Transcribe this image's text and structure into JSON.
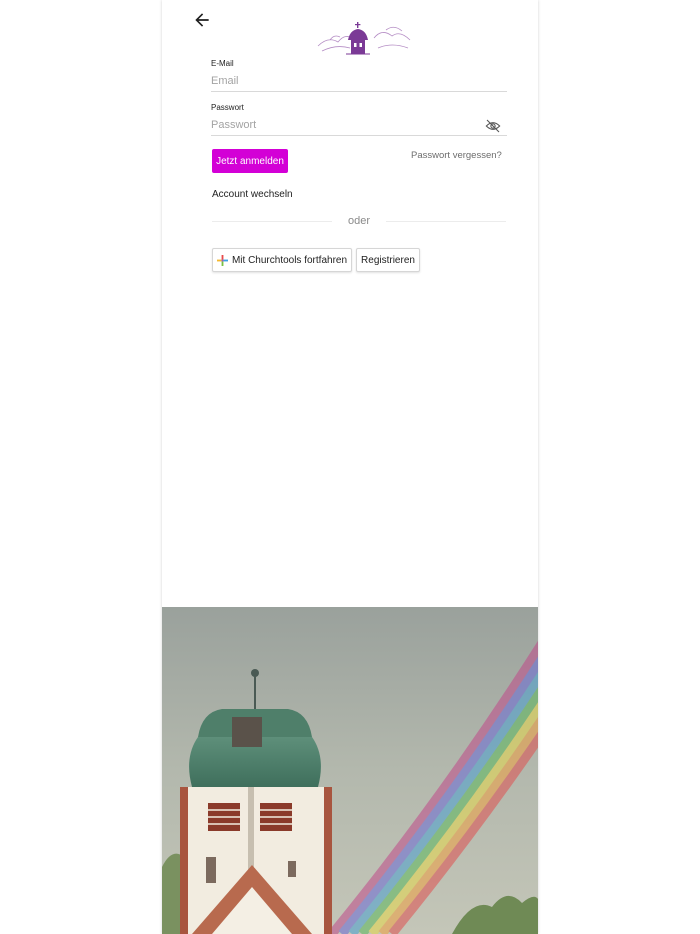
{
  "colors": {
    "accent": "#d300d6",
    "logo": "#7b3a96"
  },
  "nav": {
    "back_icon": "arrow-left-icon"
  },
  "login": {
    "email_label": "E-Mail",
    "email_placeholder": "Email",
    "password_label": "Passwort",
    "password_placeholder": "Passwort",
    "password_toggle_icon": "eye-off-icon",
    "submit_label": "Jetzt anmelden",
    "forgot_label": "Passwort vergessen?",
    "switch_account_label": "Account wechseln",
    "divider_label": "oder",
    "churchtools_label": "Mit Churchtools fortfahren",
    "register_label": "Registrieren"
  }
}
